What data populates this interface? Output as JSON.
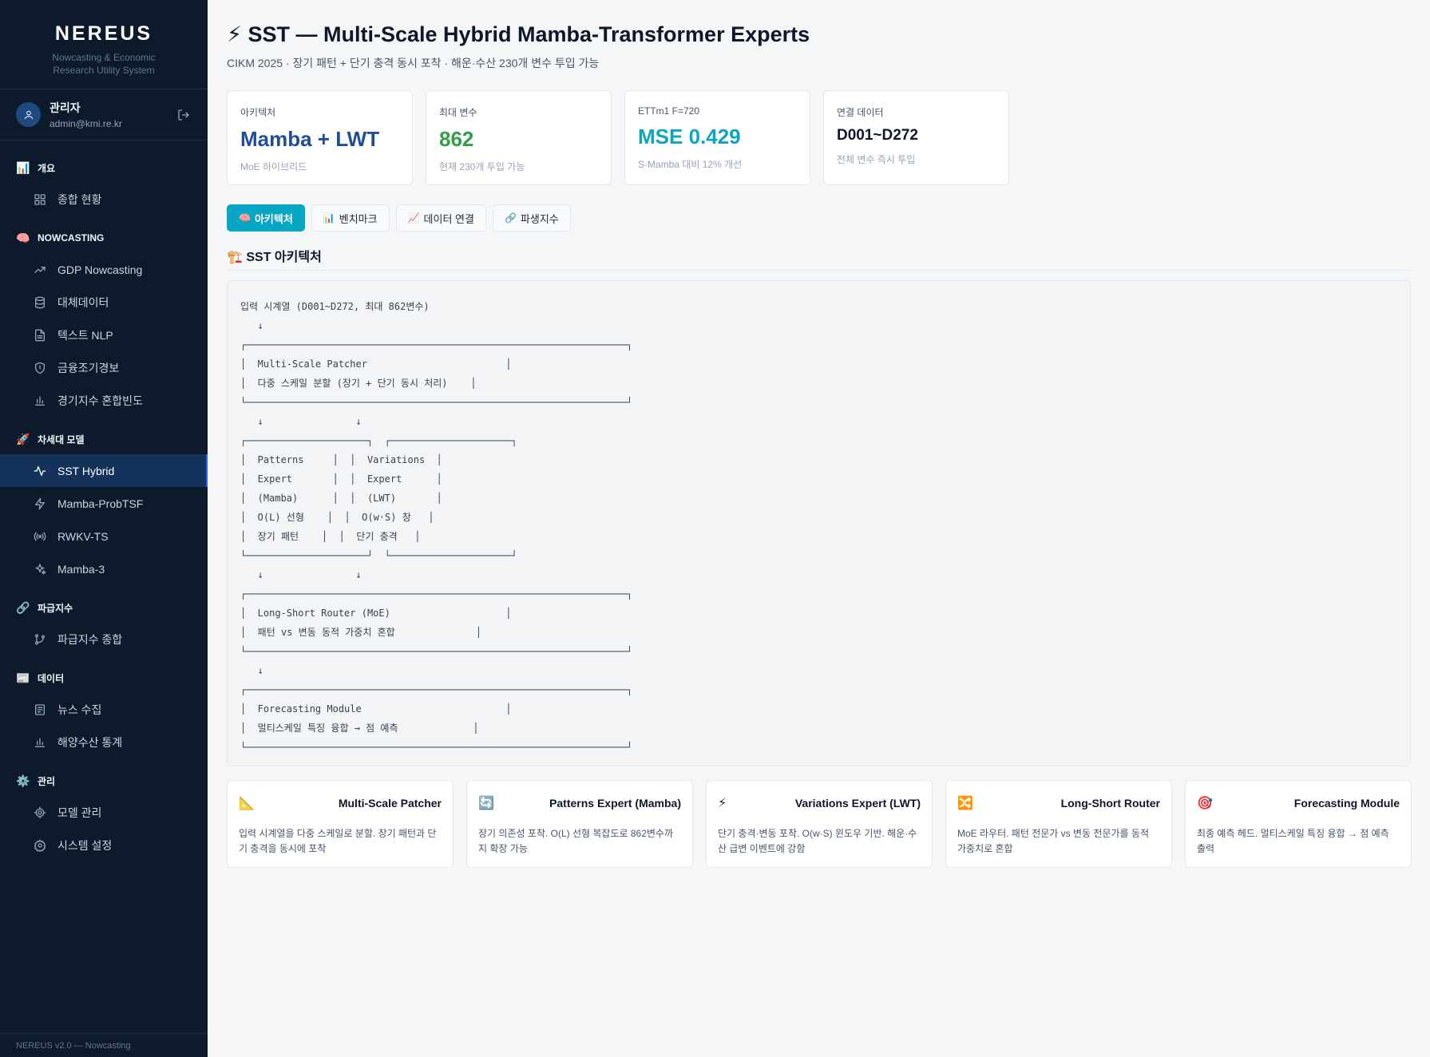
{
  "sidebar": {
    "brand": "NEREUS",
    "brand_sub_1": "Nowcasting & Economic",
    "brand_sub_2": "Research Utility System",
    "user": {
      "name": "관리자",
      "email": "admin@kmi.re.kr"
    },
    "sections": [
      {
        "icon": "📊",
        "label": "개요",
        "items": [
          {
            "label": "종합 현황",
            "icon": "dashboard-icon"
          }
        ]
      },
      {
        "icon": "🧠",
        "label": "NOWCASTING",
        "items": [
          {
            "label": "GDP Nowcasting",
            "icon": "trending-up-icon"
          },
          {
            "label": "대체데이터",
            "icon": "database-icon"
          },
          {
            "label": "텍스트 NLP",
            "icon": "document-icon"
          },
          {
            "label": "금융조기경보",
            "icon": "shield-icon"
          },
          {
            "label": "경기지수 혼합빈도",
            "icon": "bar-chart-icon"
          }
        ]
      },
      {
        "icon": "🚀",
        "label": "차세대 모델",
        "items": [
          {
            "label": "SST Hybrid",
            "icon": "activity-icon",
            "active": true
          },
          {
            "label": "Mamba-ProbTSF",
            "icon": "zap-icon"
          },
          {
            "label": "RWKV-TS",
            "icon": "radio-icon"
          },
          {
            "label": "Mamba-3",
            "icon": "sparkle-icon"
          }
        ]
      },
      {
        "icon": "🔗",
        "label": "파급지수",
        "items": [
          {
            "label": "파급지수 종합",
            "icon": "git-branch-icon"
          }
        ]
      },
      {
        "icon": "📰",
        "label": "데이터",
        "items": [
          {
            "label": "뉴스 수집",
            "icon": "newspaper-icon"
          },
          {
            "label": "해양수산 통계",
            "icon": "bar-chart-icon"
          }
        ]
      },
      {
        "icon": "⚙️",
        "label": "관리",
        "items": [
          {
            "label": "모델 관리",
            "icon": "cpu-icon"
          },
          {
            "label": "시스템 설정",
            "icon": "settings-icon"
          }
        ]
      }
    ],
    "footer": "NEREUS v2.0 — Nowcasting"
  },
  "header": {
    "title": "⚡ SST — Multi-Scale Hybrid Mamba-Transformer Experts",
    "subtitle": "CIKM 2025 · 장기 패턴 + 단기 충격 동시 포착 · 해운·수산 230개 변수 투입 가능"
  },
  "stats": [
    {
      "label": "아키텍처",
      "value": "Mamba + LWT",
      "note": "MoE 하이브리드",
      "color": "#1e4e9a"
    },
    {
      "label": "최대 변수",
      "value": "862",
      "note": "현재 230개 투입 가능",
      "color": "#2f9e44"
    },
    {
      "label": "ETTm1 F=720",
      "value": "MSE 0.429",
      "note": "S-Mamba 대비 12% 개선",
      "color": "#0ea5c0"
    },
    {
      "label": "연결 데이터",
      "value": "D001~D272",
      "note": "전체 변수 즉시 투입",
      "color": "#0f172a"
    }
  ],
  "tabs": [
    {
      "emoji": "🧠",
      "label": "아키텍처",
      "active": true
    },
    {
      "emoji": "📊",
      "label": "벤치마크"
    },
    {
      "emoji": "📈",
      "label": "데이터 연결"
    },
    {
      "emoji": "🔗",
      "label": "파생지수"
    }
  ],
  "section_title": "🏗️ SST 아키텍처",
  "diagram_text": "입력 시계열 (D001~D272, 최대 862변수)\n   ↓\n┌──────────────────────────────────────────────────────────────────┐\n│  Multi-Scale Patcher                        │\n│  다중 스케일 분할 (장기 + 단기 동시 처리)    │\n└──────────────────────────────────────────────────────────────────┘\n   ↓                ↓\n┌─────────────────────┐  ┌─────────────────────┐\n│  Patterns     │  │  Variations  │\n│  Expert       │  │  Expert      │\n│  (Mamba)      │  │  (LWT)       │\n│  O(L) 선형    │  │  O(w·S) 창   │\n│  장기 패턴    │  │  단기 충격   │\n└─────────────────────┘  └─────────────────────┘\n   ↓                ↓\n┌──────────────────────────────────────────────────────────────────┐\n│  Long-Short Router (MoE)                    │\n│  패턴 vs 변동 동적 가중치 혼합              │\n└──────────────────────────────────────────────────────────────────┘\n   ↓\n┌──────────────────────────────────────────────────────────────────┐\n│  Forecasting Module                         │\n│  멀티스케일 특징 융합 → 점 예측             │\n└──────────────────────────────────────────────────────────────────┘",
  "cards": [
    {
      "icon": "📐",
      "title": "Multi-Scale Patcher",
      "desc": "입력 시계열을 다중 스케일로 분할. 장기 패턴과 단기 충격을 동시에 포착"
    },
    {
      "icon": "🔄",
      "title": "Patterns Expert (Mamba)",
      "desc": "장기 의존성 포착. O(L) 선형 복잡도로 862변수까지 확장 가능"
    },
    {
      "icon": "⚡",
      "title": "Variations Expert (LWT)",
      "desc": "단기 충격·변동 포착. O(w·S) 윈도우 기반. 해운·수산 급변 이벤트에 강함"
    },
    {
      "icon": "🔀",
      "title": "Long-Short Router",
      "desc": "MoE 라우터. 패턴 전문가 vs 변동 전문가를 동적 가중치로 혼합"
    },
    {
      "icon": "🎯",
      "title": "Forecasting Module",
      "desc": "최종 예측 헤드. 멀티스케일 특징 융합 → 점 예측 출력"
    }
  ]
}
